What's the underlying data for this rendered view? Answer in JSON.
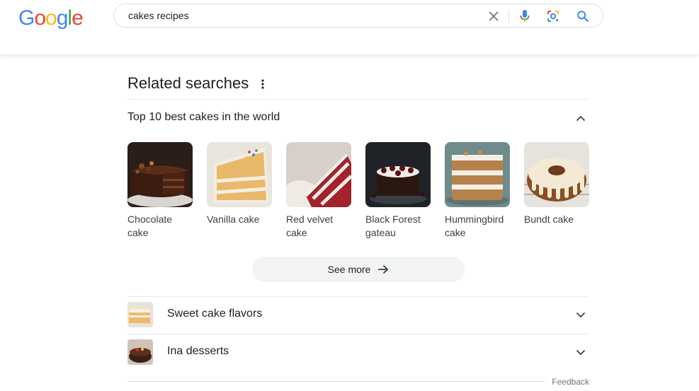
{
  "header": {
    "logo_letters": [
      "G",
      "o",
      "o",
      "g",
      "l",
      "e"
    ],
    "logo_colors": [
      "#4285F4",
      "#EA4335",
      "#FBBC05",
      "#4285F4",
      "#34A853",
      "#EA4335"
    ],
    "search_value": "cakes recipes",
    "icons": {
      "clear": "close-icon",
      "mic": "microphone-icon",
      "lens": "google-lens-icon",
      "search": "search-icon"
    }
  },
  "related": {
    "title": "Related searches",
    "top_section": {
      "title": "Top 10 best cakes in the world",
      "expanded": true,
      "items": [
        {
          "label": "Chocolate cake"
        },
        {
          "label": "Vanilla cake"
        },
        {
          "label": "Red velvet cake"
        },
        {
          "label": "Black Forest gateau"
        },
        {
          "label": "Hummingbird cake"
        },
        {
          "label": "Bundt cake"
        }
      ],
      "see_more": "See more"
    },
    "rows": [
      {
        "label": "Sweet cake flavors"
      },
      {
        "label": "Ina desserts"
      }
    ],
    "feedback": "Feedback"
  },
  "colors": {
    "accent_blue": "#4285F4",
    "text_dark": "#202124",
    "divider": "#e8eaed",
    "button_bg": "#f1f3f4"
  }
}
